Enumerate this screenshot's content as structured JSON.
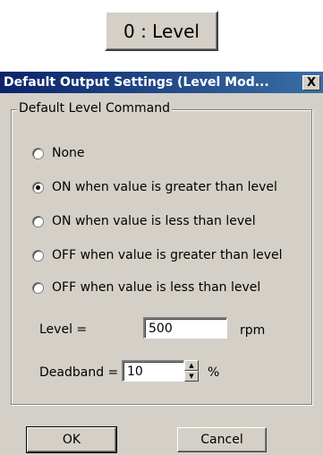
{
  "mode_button": {
    "label": "0 : Level"
  },
  "dialog": {
    "title": "Default Output Settings (Level Mod...",
    "close_label": "X",
    "group": {
      "title": "Default Level Command",
      "options": [
        {
          "label": "None",
          "checked": false
        },
        {
          "label": "ON when value is greater than level",
          "checked": true
        },
        {
          "label": "ON when value is less than level",
          "checked": false
        },
        {
          "label": "OFF when value is greater than level",
          "checked": false
        },
        {
          "label": "OFF when value is less than level",
          "checked": false
        }
      ],
      "level": {
        "label": "Level =",
        "value": "500",
        "unit": "rpm"
      },
      "deadband": {
        "label": "Deadband =",
        "value": "10",
        "unit": "%",
        "up_icon": "spin-up-icon",
        "down_icon": "spin-down-icon"
      }
    },
    "buttons": {
      "ok": "OK",
      "cancel": "Cancel"
    }
  }
}
